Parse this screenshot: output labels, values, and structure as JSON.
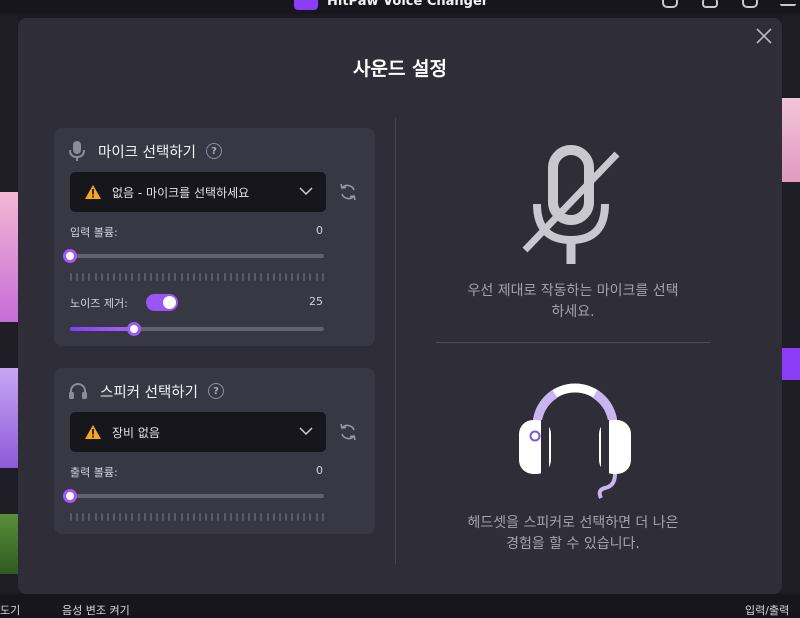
{
  "app": {
    "title": "HitPaw Voice Changer",
    "bottom_left_label": "도기",
    "bottom_mid_label": "음성 변조 켜기",
    "bottom_right_label": "입력/출력"
  },
  "modal": {
    "title": "사운드 설정",
    "mic": {
      "header": "마이크 선택하기",
      "help": "?",
      "selected": "없음 - 마이크를 선택하세요",
      "input_volume_label": "입력 볼륨:",
      "input_volume_value": "0",
      "input_volume_level": 0,
      "noise_label": "노이즈 제거:",
      "noise_enabled": true,
      "noise_value": "25",
      "noise_level": 0.25
    },
    "speaker": {
      "header": "스피커 선택하기",
      "help": "?",
      "selected": "장비 없음",
      "output_volume_label": "출력 볼륨:",
      "output_volume_value": "0",
      "output_volume_level": 0
    },
    "info_mic": "우선 제대로 작동하는 마이크를 선택하세요.",
    "info_mic_line1": "우선 제대로 작동하는 마이크를 선택",
    "info_mic_line2": "하세요.",
    "info_speaker_line1": "헤드셋을 스피커로 선택하면 더 나은",
    "info_speaker_line2": "경험을 할 수 있습니다."
  },
  "colors": {
    "accent": "#9a55f5",
    "warning": "#f5a623",
    "modal_bg": "#2e2d38",
    "card_bg": "#383744"
  },
  "icons": [
    "microphone-icon",
    "help-icon",
    "warning-icon",
    "chevron-down-icon",
    "refresh-icon",
    "headphones-icon",
    "close-icon",
    "microphone-off-icon"
  ]
}
